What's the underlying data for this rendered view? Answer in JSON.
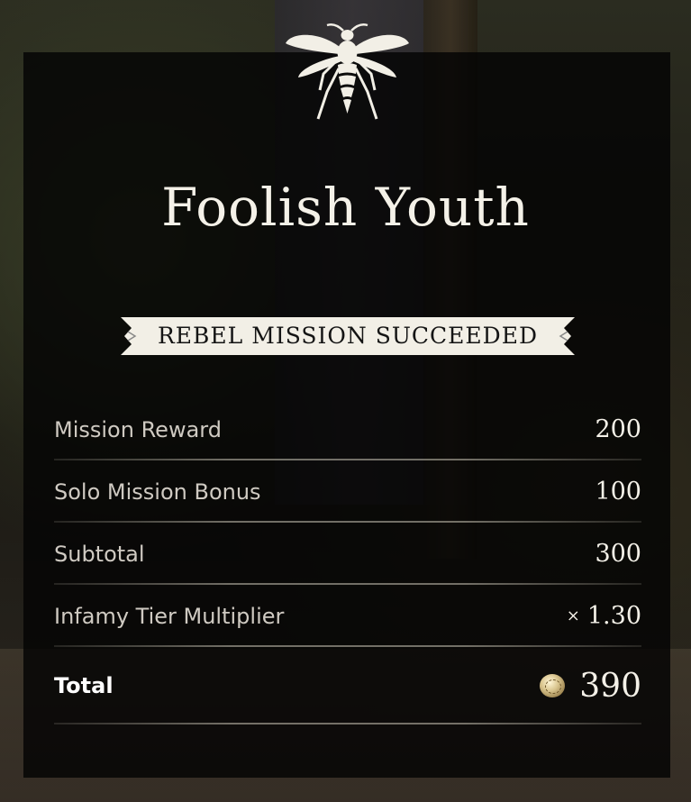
{
  "mission": {
    "title": "Foolish Youth",
    "status": "REBEL MISSION SUCCEEDED"
  },
  "rewards": [
    {
      "label": "Mission Reward",
      "value": "200"
    },
    {
      "label": "Solo Mission Bonus",
      "value": "100"
    },
    {
      "label": "Subtotal",
      "value": "300"
    },
    {
      "label": "Infamy Tier Multiplier",
      "prefix": "×",
      "value": "1.30"
    }
  ],
  "total": {
    "label": "Total",
    "value": "390",
    "icon": "coin-icon"
  },
  "emblem": "bee-icon",
  "colors": {
    "panel": "#050505",
    "text": "#f4f1e8",
    "label": "#cfcac2",
    "banner": "#f4f1e8"
  }
}
